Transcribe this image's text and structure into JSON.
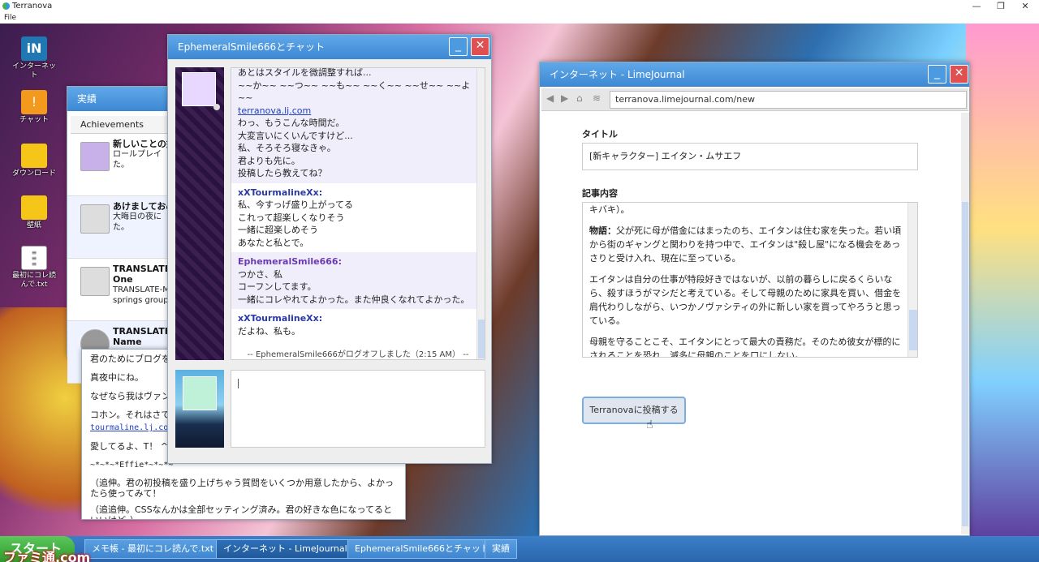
{
  "host": {
    "app_title": "Terranova",
    "menu_file": "File",
    "ctrl_min": "—",
    "ctrl_max": "❐",
    "ctrl_close": "✕"
  },
  "desktop_icons": [
    {
      "glyph": "iN",
      "label": "インターネット"
    },
    {
      "glyph": "!",
      "label": "チャット"
    },
    {
      "glyph": "",
      "label": "ダウンロード"
    },
    {
      "glyph": "",
      "label": "壁紙"
    },
    {
      "glyph": "",
      "label": "最初にコレ読んで.txt"
    }
  ],
  "achievements": {
    "title": "実績",
    "header": "Achievements",
    "items": [
      {
        "title": "新しいことの始",
        "desc": "ロールプレイ\nた。"
      },
      {
        "title": "あけましておめ",
        "desc": "大晦日の夜に\nた。"
      },
      {
        "title": "TRANSLATE-M",
        "sub": "One",
        "desc": "TRANSLATE-M\nsprings group"
      },
      {
        "title": "TRANSLATE-M",
        "sub": "Name",
        "desc": ""
      }
    ]
  },
  "memo": {
    "lines": [
      "君のためにブログを",
      "真夜中にね。",
      "なぜなら我はヴァン",
      "コホン。それはさて",
      "tourmaline.lj.com",
      "愛してるよ、T！ ^_",
      "~*~*~*Effie*~*~*~",
      "（追伸。君の初投稿を盛り上げちゃう質問をいくつか用意したから、よかったら使ってみて！",
      "（追追伸。CSSなんかは全部セッティング済み。君の好きな色になってるといいけど。）"
    ]
  },
  "chat": {
    "title": "EphemeralSmile666とチャット",
    "messages": [
      {
        "who": "",
        "lines": [
          "あとはスタイルを微調整すれば...",
          "~~か~~ ~~つ~~ ~~も~~ ~~く~~ ~~せ~~ ~~よ~~"
        ],
        "link": "terranova.lj.com",
        "lines2": [
          "わっ、もうこんな時間だ。",
          "大変言いにくいんですけど...",
          "私、そろそろ寝なきゃ。",
          "君よりも先に。",
          "投稿したら教えてね？"
        ]
      },
      {
        "who": "xXTourmalineXx:",
        "lines": [
          "私、今すっげ盛り上がってる",
          "これって超楽しくなりそう",
          "一緒に超楽しめそう",
          "あなたと私とで。"
        ]
      },
      {
        "who": "EphemeralSmile666:",
        "lines": [
          "つかさ、私",
          "コーフンしてます。",
          "一緒にコレやれてよかった。また仲良くなれてよかった。"
        ]
      },
      {
        "who": "xXTourmalineXx:",
        "lines": [
          "だよね、私も。"
        ]
      }
    ],
    "logoff": "-- EphemeralSmile666がログオフしました（2:15 AM） --"
  },
  "browser": {
    "title": "インターネット - LimeJournal",
    "url": "terranova.limejournal.com/new",
    "title_label": "タイトル",
    "title_value": "[新キャラクター] エイタン・ムサエフ",
    "body_label": "記事内容",
    "body_paragraphs": [
      "キバキ）。",
      "物語：父が死に母が借金にはまったのち、エイタンは住む家を失った。若い頃から街のギャングと関わりを持つ中で、エイタンは\"殺し屋\"になる機会をあっさりと受け入れ、現在に至っている。",
      "エイタンは自分の仕事が特段好きではないが、以前の暮らしに戻るくらいなら、殺すほうがマシだと考えている。そして母親のために家具を買い、借金を肩代わりしながら、いつかノヴァシティの外に新しい家を買ってやろうと思っている。",
      "母親を守ることこそ、エイタンにとって最大の責務だ。そのため彼女が標的にされることを恐れ、滅多に母親のことを口にしない。"
    ],
    "story_bold": "物語：",
    "post_button": "Terranovaに投稿する"
  },
  "taskbar": {
    "start": "スタート",
    "items": [
      {
        "label": "メモ帳 - 最初にコレ読んで.txt"
      },
      {
        "label": "インターネット - LimeJournal"
      },
      {
        "label": "EphemeralSmile666とチャット"
      },
      {
        "label": "実績"
      }
    ]
  },
  "watermark": "ファミ通.com"
}
